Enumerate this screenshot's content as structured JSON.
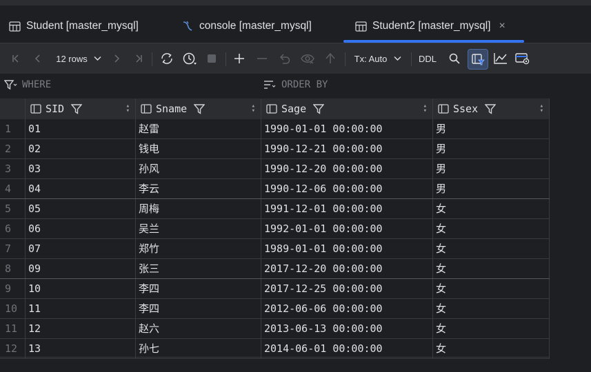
{
  "tabs": [
    {
      "label": "Student [master_mysql]",
      "icon": "table-icon",
      "active": false
    },
    {
      "label": "console [master_mysql]",
      "icon": "mysql-console-icon",
      "active": false
    },
    {
      "label": "Student2 [master_mysql]",
      "icon": "table-icon",
      "active": true,
      "close": "×"
    }
  ],
  "toolbar": {
    "rows_label": "12 rows",
    "tx_label": "Tx: Auto",
    "ddl_label": "DDL"
  },
  "filters": {
    "where": "WHERE",
    "order_by": "ORDER BY"
  },
  "columns": [
    "SID",
    "Sname",
    "Sage",
    "Ssex"
  ],
  "rows": [
    [
      "1",
      "01",
      "赵雷",
      "1990-01-01 00:00:00",
      "男"
    ],
    [
      "2",
      "02",
      "钱电",
      "1990-12-21 00:00:00",
      "男"
    ],
    [
      "3",
      "03",
      "孙风",
      "1990-12-20 00:00:00",
      "男"
    ],
    [
      "4",
      "04",
      "李云",
      "1990-12-06 00:00:00",
      "男"
    ],
    [
      "5",
      "05",
      "周梅",
      "1991-12-01 00:00:00",
      "女"
    ],
    [
      "6",
      "06",
      "吴兰",
      "1992-01-01 00:00:00",
      "女"
    ],
    [
      "7",
      "07",
      "郑竹",
      "1989-01-01 00:00:00",
      "女"
    ],
    [
      "8",
      "09",
      "张三",
      "2017-12-20 00:00:00",
      "女"
    ],
    [
      "9",
      "10",
      "李四",
      "2017-12-25 00:00:00",
      "女"
    ],
    [
      "10",
      "11",
      "李四",
      "2012-06-06 00:00:00",
      "女"
    ],
    [
      "11",
      "12",
      "赵六",
      "2013-06-13 00:00:00",
      "女"
    ],
    [
      "12",
      "13",
      "孙七",
      "2014-06-01 00:00:00",
      "女"
    ]
  ],
  "colors": {
    "accent": "#3574f0",
    "background": "#1e1f22",
    "panel": "#2b2d30"
  }
}
